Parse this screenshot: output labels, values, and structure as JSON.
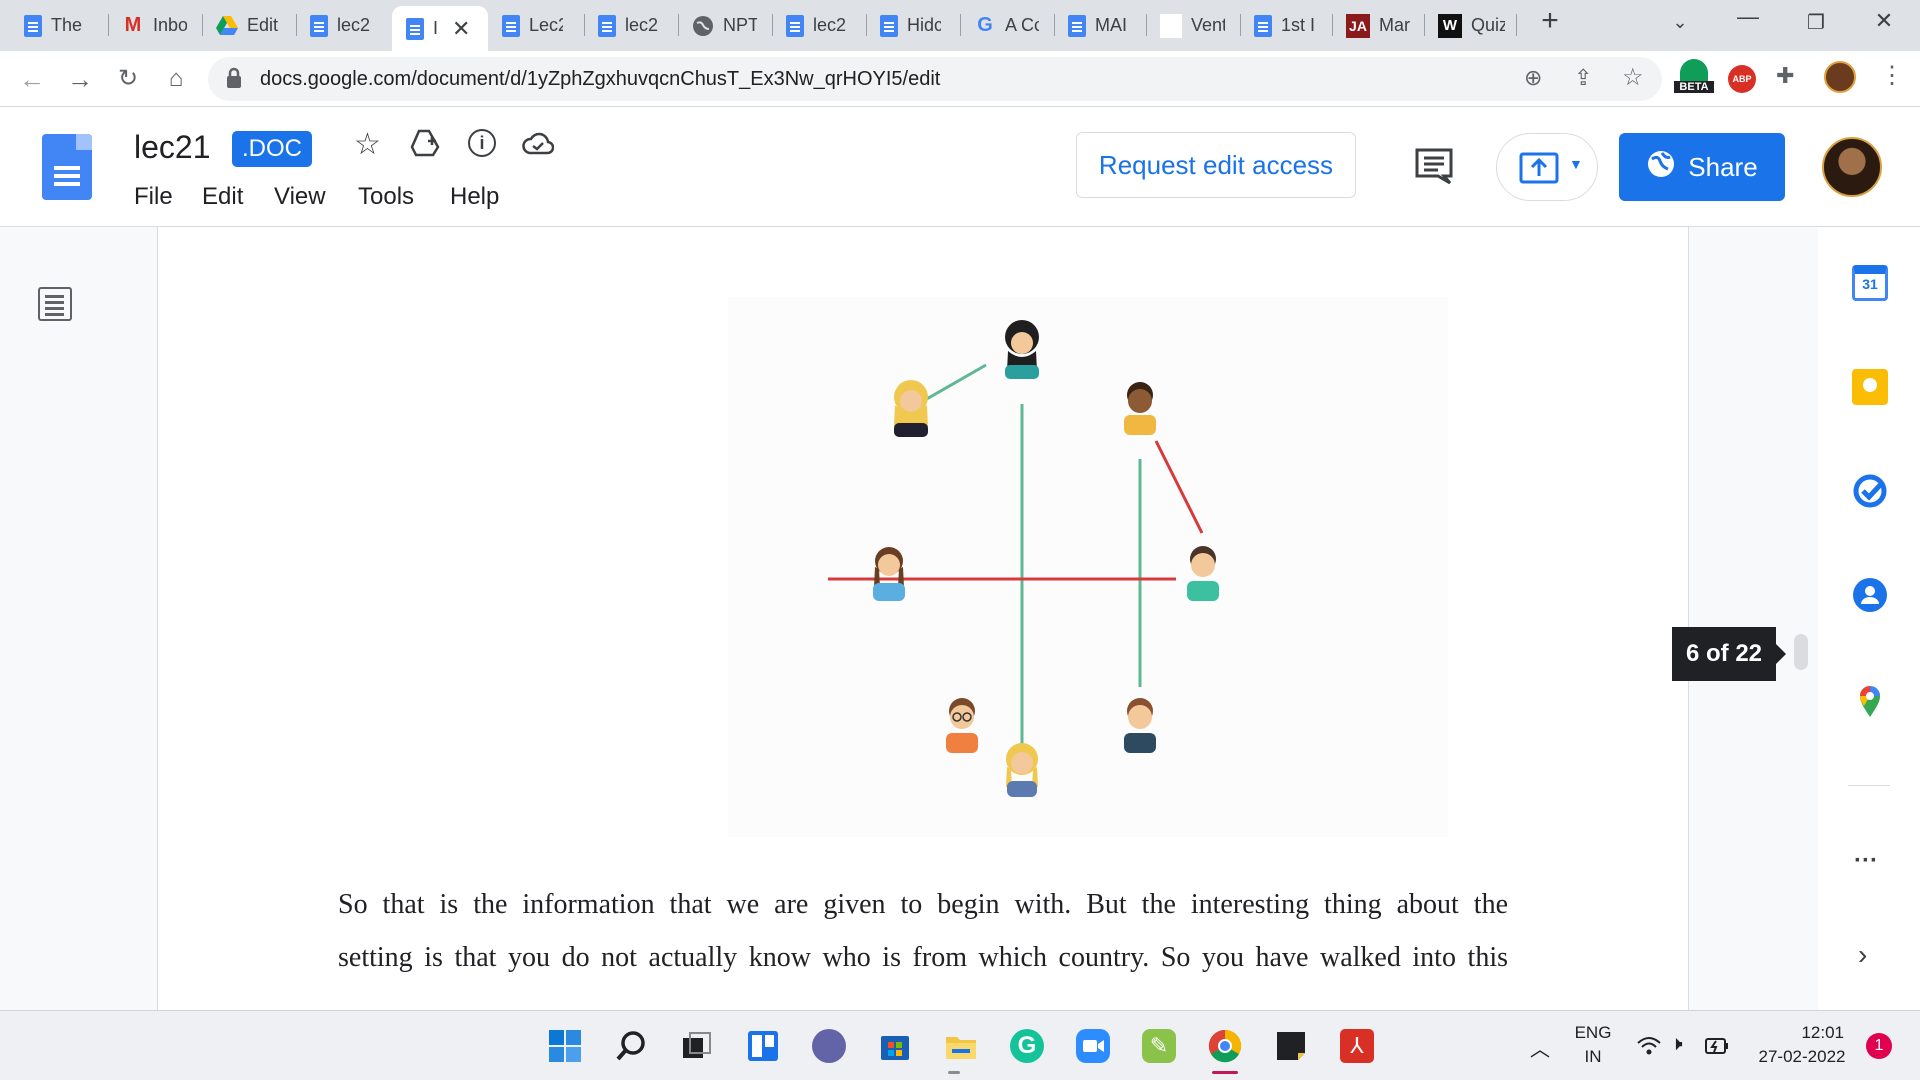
{
  "browser": {
    "tabs": [
      {
        "label": "The",
        "icon": "docs-icon"
      },
      {
        "label": "Inbo",
        "icon": "gmail-icon"
      },
      {
        "label": "Edit",
        "icon": "drive-icon"
      },
      {
        "label": "lec2",
        "icon": "docs-icon"
      },
      {
        "label": "I",
        "icon": "docs-icon",
        "active": true
      },
      {
        "label": "Lec2",
        "icon": "docs-icon"
      },
      {
        "label": "lec2",
        "icon": "docs-icon"
      },
      {
        "label": "NPT",
        "icon": "globe-icon"
      },
      {
        "label": "lec2",
        "icon": "docs-icon"
      },
      {
        "label": "Hidc",
        "icon": "docs-icon"
      },
      {
        "label": "A Cc",
        "icon": "google-icon"
      },
      {
        "label": "MAI",
        "icon": "docs-icon"
      },
      {
        "label": "Vent",
        "icon": "blank-page-icon"
      },
      {
        "label": "1st I",
        "icon": "docs-icon"
      },
      {
        "label": "Mar",
        "icon": "ja-icon"
      },
      {
        "label": "Quiz",
        "icon": "w-icon"
      }
    ],
    "url": "docs.google.com/document/d/1yZphZgxhuvqcnChusT_Ex3Nw_qrHOYI5/edit",
    "beta_label": "BETA",
    "abp_label": "ABP"
  },
  "docs": {
    "title": "lec21",
    "badge": ".DOC",
    "menu": [
      "File",
      "Edit",
      "View",
      "Tools",
      "Help"
    ],
    "request_edit": "Request edit access",
    "share": "Share",
    "page_indicator": "6 of 22",
    "calendar_day": "31"
  },
  "document": {
    "paragraph_lines": [
      "So that is the information that we are given to begin with. But the interesting thing about the",
      "setting is that you do not actually know who is from which country. So you have walked into this"
    ]
  },
  "taskbar": {
    "lang_top": "ENG",
    "lang_bottom": "IN",
    "time": "12:01",
    "date": "27-02-2022",
    "notification_count": "1"
  },
  "colors": {
    "accent": "#1a73e8",
    "green_edge": "#5fb894",
    "red_edge": "#d63a3a"
  }
}
